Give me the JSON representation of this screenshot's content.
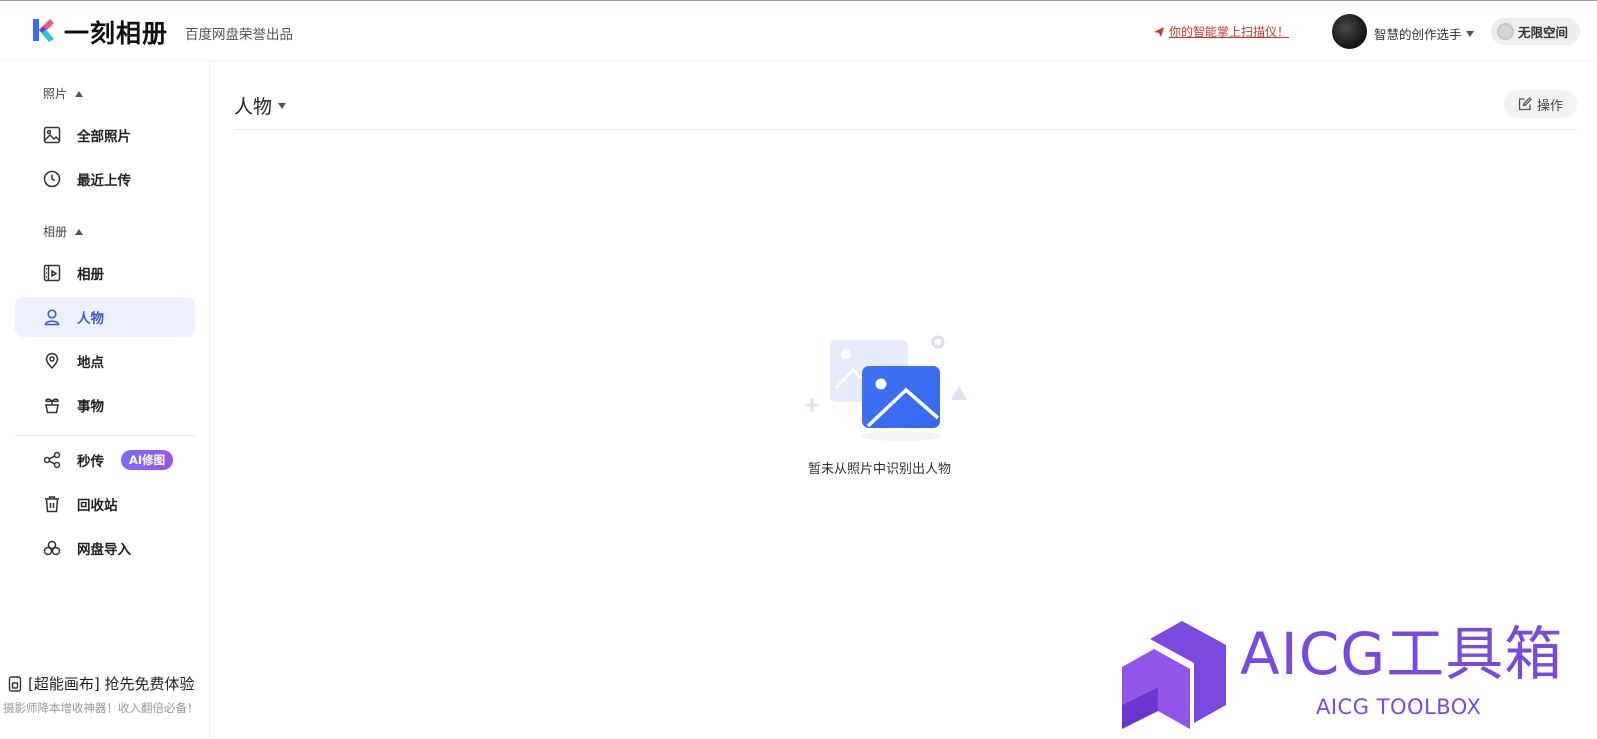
{
  "header": {
    "app_name": "一刻相册",
    "tagline": "百度网盘荣誉出品",
    "promo_link": "你的智能掌上扫描仪！",
    "username": "智慧的创作选手",
    "space_label": "无限空间"
  },
  "sidebar": {
    "photos_section": "照片",
    "albums_section": "相册",
    "items": [
      {
        "label": "全部照片",
        "icon": "image-icon"
      },
      {
        "label": "最近上传",
        "icon": "clock-icon"
      },
      {
        "label": "相册",
        "icon": "album-icon"
      },
      {
        "label": "人物",
        "icon": "person-icon",
        "active": true
      },
      {
        "label": "地点",
        "icon": "location-pin-icon"
      },
      {
        "label": "事物",
        "icon": "plant-pot-icon"
      },
      {
        "label": "秒传",
        "icon": "share-nodes-icon",
        "badge": "AI修图"
      },
      {
        "label": "回收站",
        "icon": "trash-icon"
      },
      {
        "label": "网盘导入",
        "icon": "cloud-import-icon"
      }
    ],
    "bottom_promo": "[超能画布] 抢先免费体验",
    "bottom_promo_sub": "摄影师降本增收神器！收入翻倍必备！"
  },
  "main": {
    "title": "人物",
    "operate_label": "操作",
    "empty_message": "暂未从照片中识别出人物"
  },
  "watermark": {
    "title": "AICG工具箱",
    "subtitle": "AICG TOOLBOX"
  },
  "colors": {
    "accent": "#3a5bd9",
    "active_bg": "#eef1fd",
    "promo_red": "#d0342c",
    "watermark_purple": "#7a49df"
  }
}
